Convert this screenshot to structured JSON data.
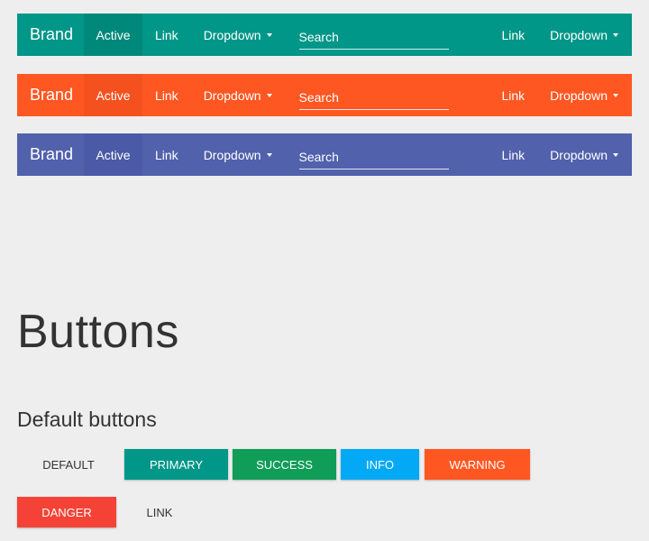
{
  "navbars": [
    {
      "brand": "Brand",
      "active": "Active",
      "link": "Link",
      "dropdown": "Dropdown",
      "search_placeholder": "Search",
      "right_link": "Link",
      "right_dropdown": "Dropdown",
      "color": "#009688"
    },
    {
      "brand": "Brand",
      "active": "Active",
      "link": "Link",
      "dropdown": "Dropdown",
      "search_placeholder": "Search",
      "right_link": "Link",
      "right_dropdown": "Dropdown",
      "color": "#ff5722"
    },
    {
      "brand": "Brand",
      "active": "Active",
      "link": "Link",
      "dropdown": "Dropdown",
      "search_placeholder": "Search",
      "right_link": "Link",
      "right_dropdown": "Dropdown",
      "color": "#5161ac"
    }
  ],
  "section_title": "Buttons",
  "subsection_title": "Default buttons",
  "buttons": {
    "default": "Default",
    "primary": "Primary",
    "success": "Success",
    "info": "Info",
    "warning": "Warning",
    "danger": "Danger",
    "link": "Link"
  },
  "icons": {
    "dropdown_caret": "chevron-down-icon"
  }
}
